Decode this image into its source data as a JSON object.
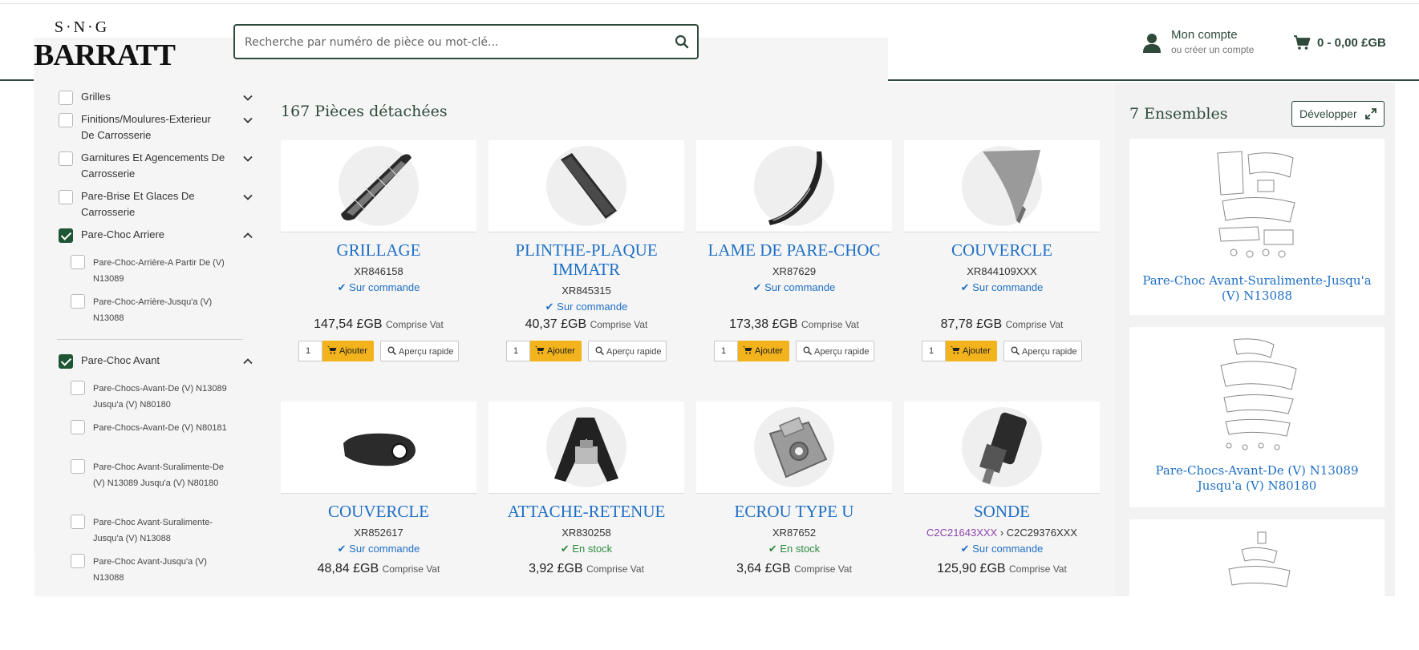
{
  "header": {
    "logo_top": "S·N·G",
    "logo_main": "BARRATT",
    "search_placeholder": "Recherche par numéro de pièce ou mot-clé...",
    "account_title": "Mon compte",
    "account_sub": "ou créer un compte",
    "cart": "0  - 0,00 £GB"
  },
  "sidebar": {
    "filters": [
      {
        "label": "Grilles",
        "checked": false,
        "expanded": false
      },
      {
        "label": "Finitions/Moulures-Exterieur De Carrosserie",
        "checked": false,
        "expanded": false
      },
      {
        "label": "Garnitures Et Agencements De Carrosserie",
        "checked": false,
        "expanded": false
      },
      {
        "label": "Pare-Brise Et Glaces De Carrosserie",
        "checked": false,
        "expanded": false
      },
      {
        "label": "Pare-Choc Arriere",
        "checked": true,
        "expanded": true
      },
      {
        "label": "Pare-Choc Avant",
        "checked": true,
        "expanded": true
      }
    ],
    "sub_arriere": [
      "Pare-Choc-Arrière-A Partir De (V) N13089",
      "Pare-Choc-Arrière-Jusqu'a (V) N13088"
    ],
    "sub_avant": [
      "Pare-Chocs-Avant-De (V) N13089 Jusqu'a (V) N80180",
      "Pare-Chocs-Avant-De (V) N80181",
      "Pare-Choc Avant-Suralimente-De (V) N13089 Jusqu'a (V) N80180",
      "Pare-Choc Avant-Suralimente-Jusqu'a (V) N13088",
      "Pare-Choc Avant-Jusqu'a (V) N13088"
    ]
  },
  "main": {
    "title": "167 Pièces détachées",
    "vat_label": "Comprise Vat",
    "add_label": "Ajouter",
    "quick_label": "Aperçu rapide",
    "qty_default": "1",
    "products": [
      {
        "name": "GRILLAGE",
        "ref": "XR846158",
        "stock": "Sur commande",
        "stock_ok": false,
        "price": "147,54 £GB",
        "icon": "mesh-grille-icon"
      },
      {
        "name": "PLINTHE-PLAQUE IMMATR",
        "ref": "XR845315",
        "stock": "Sur commande",
        "stock_ok": false,
        "price": "40,37 £GB",
        "icon": "plate-plinth-icon"
      },
      {
        "name": "LAME DE PARE-CHOC",
        "ref": "XR87629",
        "stock": "Sur commande",
        "stock_ok": false,
        "price": "173,38 £GB",
        "icon": "bumper-blade-icon"
      },
      {
        "name": "COUVERCLE",
        "ref": "XR844109XXX",
        "stock": "Sur commande",
        "stock_ok": false,
        "price": "87,78 £GB",
        "icon": "cover-panel-icon"
      },
      {
        "name": "COUVERCLE",
        "ref": "XR852617",
        "stock": "Sur commande",
        "stock_ok": false,
        "price": "48,84 £GB",
        "icon": "fog-cover-icon"
      },
      {
        "name": "ATTACHE-RETENUE",
        "ref": "XR830258",
        "stock": "En stock",
        "stock_ok": true,
        "price": "3,92 £GB",
        "icon": "retainer-clip-icon"
      },
      {
        "name": "ECROU TYPE U",
        "ref": "XR87652",
        "stock": "En stock",
        "stock_ok": true,
        "price": "3,64 £GB",
        "icon": "u-nut-icon"
      },
      {
        "name": "SONDE",
        "ref_old": "C2C21643XXX",
        "ref": "C2C29376XXX",
        "stock": "Sur commande",
        "stock_ok": false,
        "price": "125,90 £GB",
        "icon": "parking-sensor-icon"
      }
    ]
  },
  "right": {
    "title": "7 Ensembles",
    "button": "Développer",
    "ensembles": [
      {
        "name": "Pare-Choc Avant-Suralimente-Jusqu'a (V) N13088"
      },
      {
        "name": "Pare-Chocs-Avant-De (V) N13089 Jusqu'a (V) N80180"
      }
    ]
  },
  "colors": {
    "brand_green": "#2e4a3a",
    "link_blue": "#1f6fc5",
    "add_yellow": "#f3b31c",
    "in_stock_green": "#2e8b3e"
  }
}
